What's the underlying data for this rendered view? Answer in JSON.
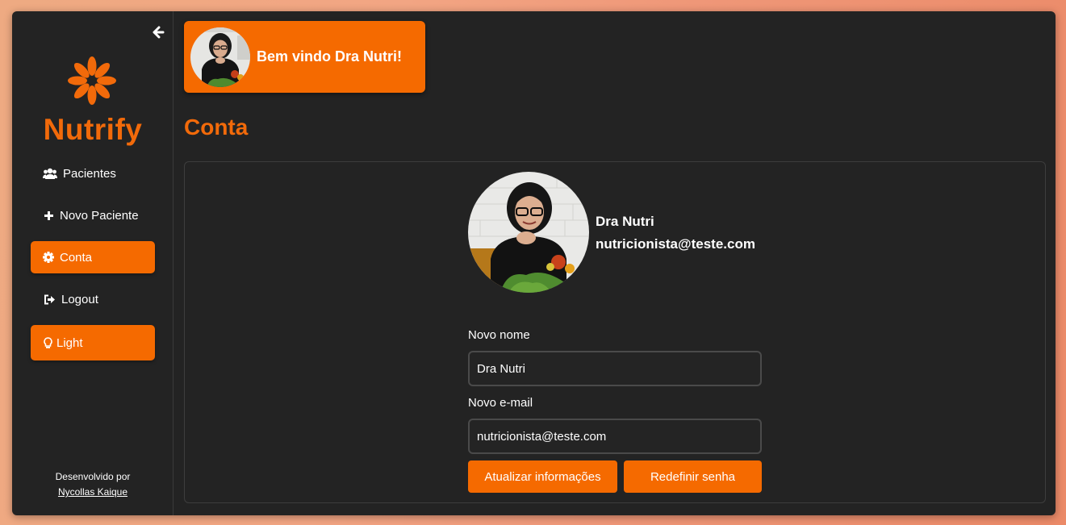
{
  "sidebar": {
    "brand": "Nutrify",
    "items": [
      {
        "label": "Pacientes",
        "icon": "users-icon"
      },
      {
        "label": "Novo Paciente",
        "icon": "plus-icon"
      },
      {
        "label": "Conta",
        "icon": "gear-icon",
        "active": true
      },
      {
        "label": "Logout",
        "icon": "logout-icon"
      },
      {
        "label": "Light",
        "icon": "lightbulb-icon",
        "active": true
      }
    ],
    "footer": {
      "text": "Desenvolvido por",
      "link": "Nycollas Kaique"
    }
  },
  "header": {
    "welcome": "Bem vindo Dra Nutri!"
  },
  "page": {
    "title": "Conta"
  },
  "profile": {
    "name": "Dra Nutri",
    "email": "nutricionista@teste.com"
  },
  "form": {
    "name_label": "Novo nome",
    "name_value": "Dra Nutri",
    "email_label": "Novo e-mail",
    "email_value": "nutricionista@teste.com",
    "update_button": "Atualizar informações",
    "reset_button": "Redefinir senha"
  },
  "colors": {
    "accent": "#f56a00",
    "brand": "#f26a0a",
    "background": "#232323"
  }
}
